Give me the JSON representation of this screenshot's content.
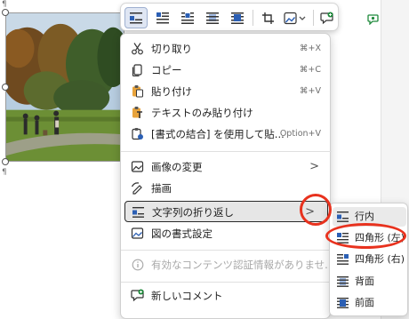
{
  "document": {
    "paragraph_mark": "¶"
  },
  "toolbar": {
    "buttons": [
      {
        "icon": "wrap-inline-icon",
        "active": true
      },
      {
        "icon": "wrap-square-icon"
      },
      {
        "icon": "wrap-tight-icon"
      },
      {
        "icon": "wrap-behind-text-icon"
      },
      {
        "icon": "wrap-in-front-icon"
      },
      {
        "icon": "crop-icon"
      },
      {
        "icon": "image-style-icon"
      },
      {
        "icon": "new-comment-icon"
      }
    ]
  },
  "context_menu": {
    "items": [
      {
        "label": "切り取り",
        "shortcut": "⌘+X",
        "icon": "scissors-icon"
      },
      {
        "label": "コピー",
        "shortcut": "⌘+C",
        "icon": "copy-icon"
      },
      {
        "label": "貼り付け",
        "shortcut": "⌘+V",
        "icon": "paste-icon"
      },
      {
        "label": "テキストのみ貼り付け",
        "icon": "paste-text-only-icon"
      },
      {
        "label": "[書式の結合] を使用して貼...",
        "shortcut": "Option+V",
        "icon": "paste-merge-icon"
      },
      {
        "label": "画像の変更",
        "icon": "change-picture-icon"
      },
      {
        "label": "描画",
        "icon": "draw-icon"
      },
      {
        "label": "文字列の折り返し",
        "icon": "wrap-text-icon"
      },
      {
        "label": "図の書式設定",
        "icon": "format-picture-icon"
      },
      {
        "label": "有効なコンテンツ認証情報がありませ...",
        "icon": "info-icon"
      },
      {
        "label": "新しいコメント",
        "icon": "new-comment-icon"
      }
    ],
    "submenu_arrow": ">"
  },
  "submenu": {
    "items": [
      {
        "label": "行内",
        "icon": "wrap-inline-icon"
      },
      {
        "label": "四角形 (左)",
        "icon": "wrap-square-left-icon"
      },
      {
        "label": "四角形 (右)",
        "icon": "wrap-square-right-icon"
      },
      {
        "label": "背面",
        "icon": "behind-text-icon"
      },
      {
        "label": "前面",
        "icon": "in-front-of-text-icon"
      }
    ]
  },
  "colors": {
    "accent_blue": "#2b5fb4",
    "annotation_red": "#e8321e",
    "comment_green": "#1f8a3c"
  }
}
